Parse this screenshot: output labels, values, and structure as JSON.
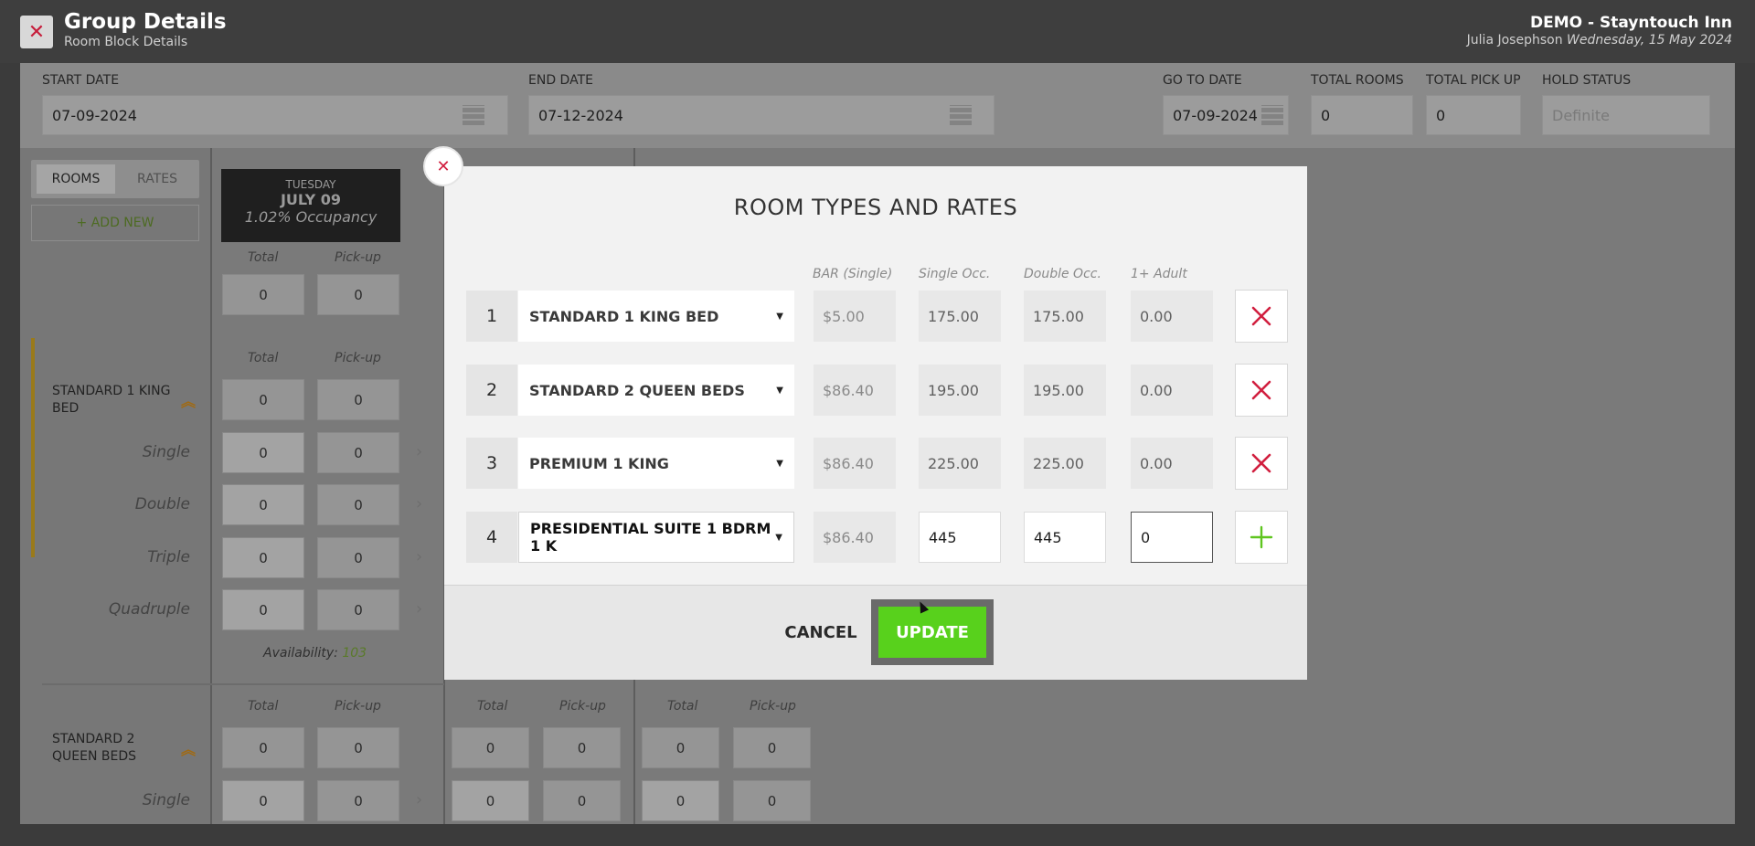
{
  "header": {
    "title": "Group Details",
    "subtitle": "Room Block Details",
    "hotel": "DEMO - Stayntouch Inn",
    "user": "Julia Josephson",
    "date": "Wednesday, 15 May 2024"
  },
  "filters": {
    "start_date_label": "START DATE",
    "start_date": "07-09-2024",
    "end_date_label": "END DATE",
    "end_date": "07-12-2024",
    "go_to_date_label": "GO TO DATE",
    "go_to_date": "07-09-2024",
    "total_rooms_label": "TOTAL ROOMS",
    "total_rooms": "0",
    "total_pickup_label": "TOTAL PICK UP",
    "total_pickup": "0",
    "hold_status_label": "HOLD STATUS",
    "hold_status": "Definite"
  },
  "left": {
    "tab_rooms": "ROOMS",
    "tab_rates": "RATES",
    "add_new": "+ ADD NEW",
    "total": "Total",
    "pickup": "Pick-up",
    "zero": "0",
    "availability_label": "Availability:",
    "availability_value": "103",
    "occupancy_types": [
      "Single",
      "Double",
      "Triple",
      "Quadruple"
    ],
    "room1_name": "STANDARD 1 KING BED",
    "room2_name": "STANDARD 2 QUEEN BEDS"
  },
  "date_card": {
    "day": "TUESDAY",
    "date": "JULY 09",
    "occupancy": "1.02% Occupancy"
  },
  "modal": {
    "title": "ROOM TYPES AND RATES",
    "columns": {
      "bar": "BAR (Single)",
      "single": "Single Occ.",
      "double": "Double Occ.",
      "adult": "1+ Adult"
    },
    "rows": [
      {
        "num": "1",
        "room": "STANDARD 1 KING BED",
        "bar": "$5.00",
        "single": "175.00",
        "double": "175.00",
        "adult": "0.00"
      },
      {
        "num": "2",
        "room": "STANDARD 2 QUEEN BEDS",
        "bar": "$86.40",
        "single": "195.00",
        "double": "195.00",
        "adult": "0.00"
      },
      {
        "num": "3",
        "room": "PREMIUM 1 KING",
        "bar": "$86.40",
        "single": "225.00",
        "double": "225.00",
        "adult": "0.00"
      },
      {
        "num": "4",
        "room": "PRESIDENTIAL SUITE 1 BDRM 1 K",
        "bar": "$86.40",
        "single": "445",
        "double": "445",
        "adult": "0"
      }
    ],
    "cancel": "CANCEL",
    "update": "UPDATE"
  },
  "colors": {
    "update_green": "#58d11c",
    "delete_red": "#d11f3f",
    "add_green": "#5fc51f"
  }
}
